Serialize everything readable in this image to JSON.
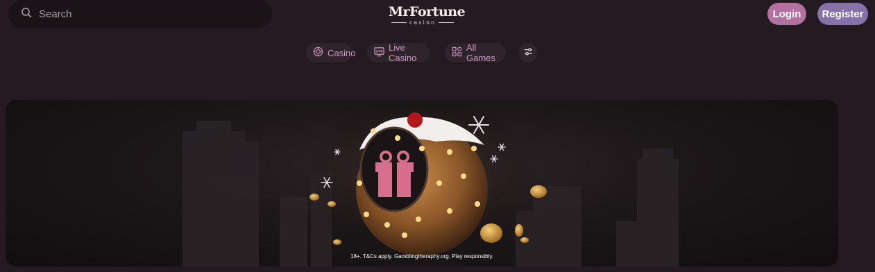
{
  "header": {
    "search": {
      "placeholder": "Search",
      "value": ""
    },
    "logo": {
      "main": "MrFortune",
      "sub": "casino"
    },
    "login_label": "Login",
    "register_label": "Register"
  },
  "nav": {
    "items": [
      {
        "label": "Casino",
        "icon": "casino-chip-icon"
      },
      {
        "label": "Live Casino",
        "icon": "live-tv-icon"
      },
      {
        "label": "All Games",
        "icon": "grid-icon"
      }
    ],
    "filter_icon": "filter-sliders-icon"
  },
  "banner": {
    "disclaimer": "18+. T&Cs apply. Gamblingtheraphy.org. Play responsibly."
  },
  "colors": {
    "background": "#241b22",
    "login": "#b4709e",
    "register": "#8672a8",
    "nav_text": "#c99abd"
  }
}
